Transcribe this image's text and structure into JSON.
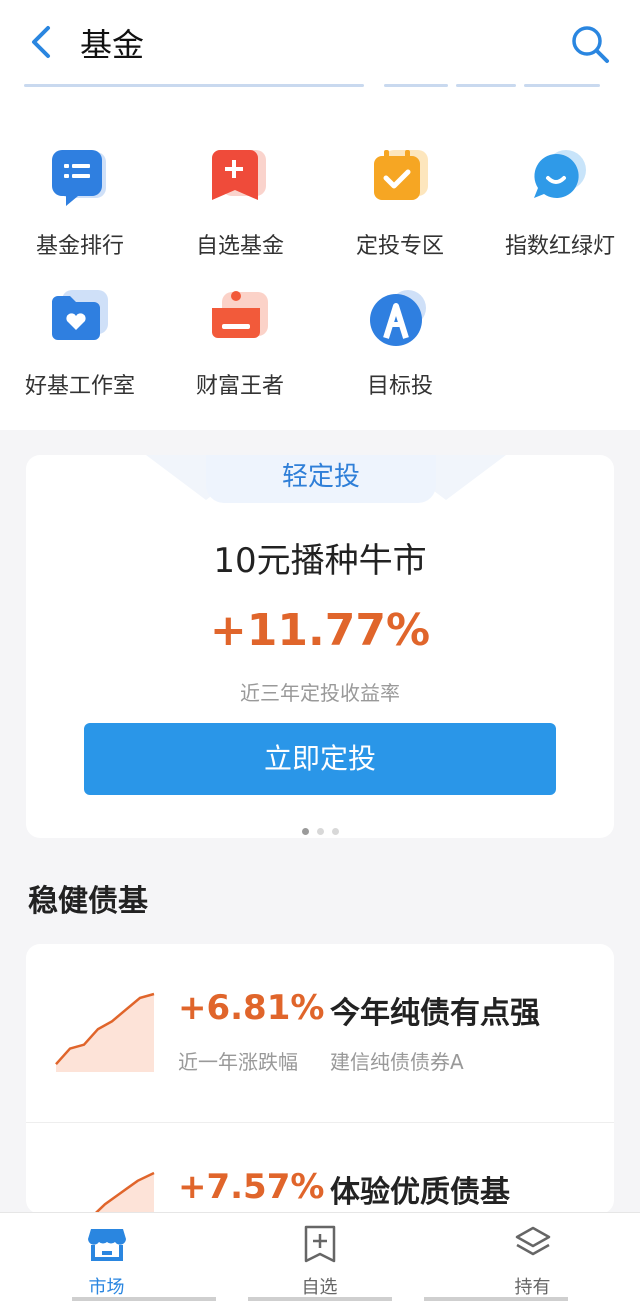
{
  "header": {
    "title": "基金"
  },
  "quick_entries": [
    {
      "label": "基金排行",
      "icon": "list-icon",
      "color": "#2f7fe0"
    },
    {
      "label": "自选基金",
      "icon": "add-bookmark-icon",
      "color": "#ef4b3a"
    },
    {
      "label": "定投专区",
      "icon": "calendar-check-icon",
      "color": "#f6a623"
    },
    {
      "label": "指数红绿灯",
      "icon": "chat-bubble-icon",
      "color": "#2f9ae8"
    },
    {
      "label": "好基工作室",
      "icon": "folder-heart-icon",
      "color": "#2f7fe0"
    },
    {
      "label": "财富王者",
      "icon": "crown-icon",
      "color": "#f25a3a"
    },
    {
      "label": "目标投",
      "icon": "target-a-icon",
      "color": "#2f7fe0"
    }
  ],
  "promo": {
    "tag": "轻定投",
    "headline": "10元播种牛市",
    "rate": "+11.77%",
    "rate_desc": "近三年定投收益率",
    "button": "立即定投",
    "page_count": 3,
    "active_page": 1
  },
  "section": {
    "title": "稳健债基"
  },
  "funds": [
    {
      "pct": "+6.81%",
      "name": "今年纯债有点强",
      "period": "近一年涨跌幅",
      "fund": "建信纯债债券A",
      "trend": [
        0.1,
        0.3,
        0.35,
        0.55,
        0.65,
        0.8,
        0.95,
        1.0
      ]
    },
    {
      "pct": "+7.57%",
      "name": "体验优质债基",
      "period": "",
      "fund": "",
      "trend": [
        0.1,
        0.3,
        0.4,
        0.6,
        0.75,
        0.9,
        1.0
      ]
    }
  ],
  "tabs": [
    {
      "label": "市场",
      "icon": "market-icon",
      "active": true
    },
    {
      "label": "自选",
      "icon": "bookmark-add-icon",
      "active": false
    },
    {
      "label": "持有",
      "icon": "layers-icon",
      "active": false
    }
  ],
  "colors": {
    "accent": "#2a96e8",
    "gain": "#e0652b"
  }
}
